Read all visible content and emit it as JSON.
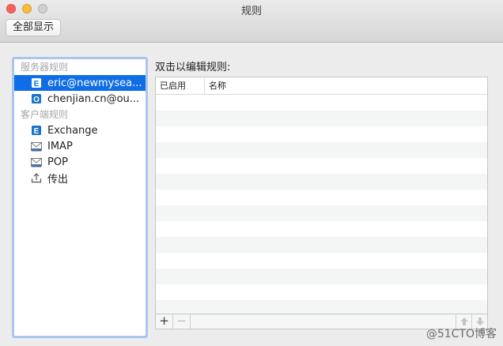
{
  "window": {
    "title": "规则",
    "show_all_label": "全部显示"
  },
  "sidebar": {
    "server_header": "服务器规则",
    "server_items": [
      {
        "label": "eric@newmysea...",
        "icon": "exchange-icon"
      },
      {
        "label": "chenjian.cn@ou...",
        "icon": "outlook-icon"
      }
    ],
    "client_header": "客户端规则",
    "client_items": [
      {
        "label": "Exchange",
        "icon": "exchange-icon"
      },
      {
        "label": "IMAP",
        "icon": "imap-icon"
      },
      {
        "label": "POP",
        "icon": "pop-icon"
      },
      {
        "label": "传出",
        "icon": "outgoing-icon"
      }
    ]
  },
  "main": {
    "caption": "双击以编辑规则:",
    "columns": {
      "enabled": "已启用",
      "name": "名称"
    },
    "add_label": "+",
    "remove_label": "−"
  },
  "colors": {
    "selection": "#0f6ee5",
    "sidebar_focus_ring": "#a9c7ee"
  },
  "watermark": "@51CTO博客"
}
